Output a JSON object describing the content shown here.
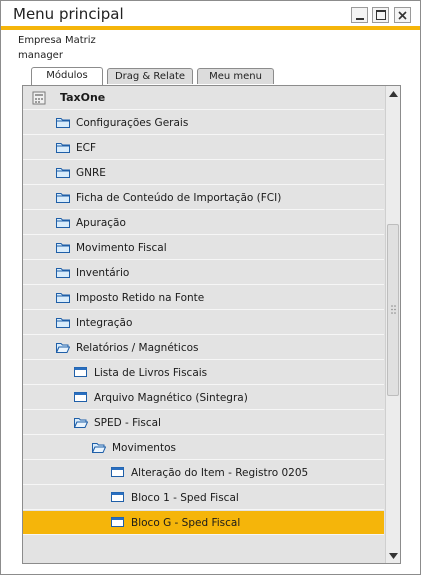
{
  "window": {
    "title": "Menu principal",
    "accent_color": "#f5b50a",
    "buttons": [
      "minimize-icon",
      "maximize-icon",
      "close-icon"
    ]
  },
  "session": {
    "company": "Empresa Matriz",
    "user": "manager"
  },
  "tabs": [
    {
      "label": "Módulos",
      "active": true
    },
    {
      "label": "Drag & Relate",
      "active": false
    },
    {
      "label": "Meu menu",
      "active": false
    }
  ],
  "tree": {
    "items": [
      {
        "label": "TaxOne",
        "icon": "module-icon",
        "level": 0
      },
      {
        "label": "Configurações Gerais",
        "icon": "folder-icon",
        "level": 1
      },
      {
        "label": "ECF",
        "icon": "folder-icon",
        "level": 1
      },
      {
        "label": "GNRE",
        "icon": "folder-icon",
        "level": 1
      },
      {
        "label": "Ficha de Conteúdo de Importação (FCI)",
        "icon": "folder-icon",
        "level": 1
      },
      {
        "label": "Apuração",
        "icon": "folder-icon",
        "level": 1
      },
      {
        "label": "Movimento Fiscal",
        "icon": "folder-icon",
        "level": 1
      },
      {
        "label": "Inventário",
        "icon": "folder-icon",
        "level": 1
      },
      {
        "label": "Imposto Retido na Fonte",
        "icon": "folder-icon",
        "level": 1
      },
      {
        "label": "Integração",
        "icon": "folder-icon",
        "level": 1
      },
      {
        "label": "Relatórios / Magnéticos",
        "icon": "folder-open-icon",
        "level": 1
      },
      {
        "label": "Lista de Livros Fiscais",
        "icon": "form-icon",
        "level": 2
      },
      {
        "label": "Arquivo Magnético (Sintegra)",
        "icon": "form-icon",
        "level": 2
      },
      {
        "label": "SPED - Fiscal",
        "icon": "folder-open-icon",
        "level": 2
      },
      {
        "label": "Movimentos",
        "icon": "folder-open-icon",
        "level": 3
      },
      {
        "label": "Alteração do Item - Registro 0205",
        "icon": "form-icon",
        "level": 4
      },
      {
        "label": "Bloco 1 - Sped Fiscal",
        "icon": "form-icon",
        "level": 4
      },
      {
        "label": "Bloco G - Sped Fiscal",
        "icon": "form-icon",
        "level": 4,
        "selected": true
      }
    ]
  }
}
